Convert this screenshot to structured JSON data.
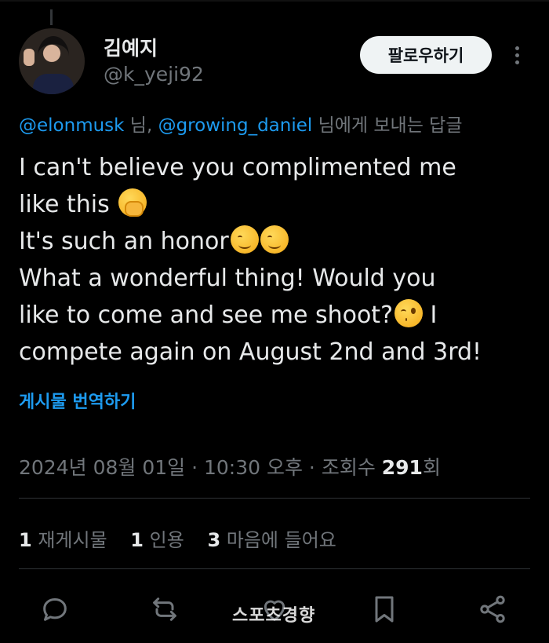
{
  "profile": {
    "name": "김예지",
    "handle": "@k_yeji92",
    "follow_label": "팔로우하기"
  },
  "reply_to": {
    "mention1": "@elonmusk",
    "sep1": " 님, ",
    "mention2": "@growing_daniel",
    "suffix": " 님에게 보내는 답글"
  },
  "tweet": {
    "line1": "I can't believe you complimented me",
    "line2": "like this ",
    "line3": "It's such an honor",
    "line4": "What a wonderful thing! Would you",
    "line5": "like to come and see me shoot?",
    "line5_tail": " I",
    "line6": "compete again on August 2nd and 3rd!"
  },
  "translate_label": "게시물 번역하기",
  "meta": {
    "date_time": "2024년 08월 01일 · 10:30 오후 · 조회수 ",
    "views": "291",
    "views_suffix": "회"
  },
  "stats": {
    "reposts_count": "1",
    "reposts_label": " 재게시물",
    "quotes_count": "1",
    "quotes_label": " 인용",
    "likes_count": "3",
    "likes_label": " 마음에 들어요"
  },
  "actions": [
    "reply-icon",
    "repost-icon",
    "like-icon",
    "bookmark-icon",
    "share-icon"
  ],
  "watermark": "스포츠경향",
  "colors": {
    "background": "#000000",
    "text": "#e7e9ea",
    "muted": "#71767b",
    "link": "#1d9bf0",
    "divider": "#2f3336"
  }
}
